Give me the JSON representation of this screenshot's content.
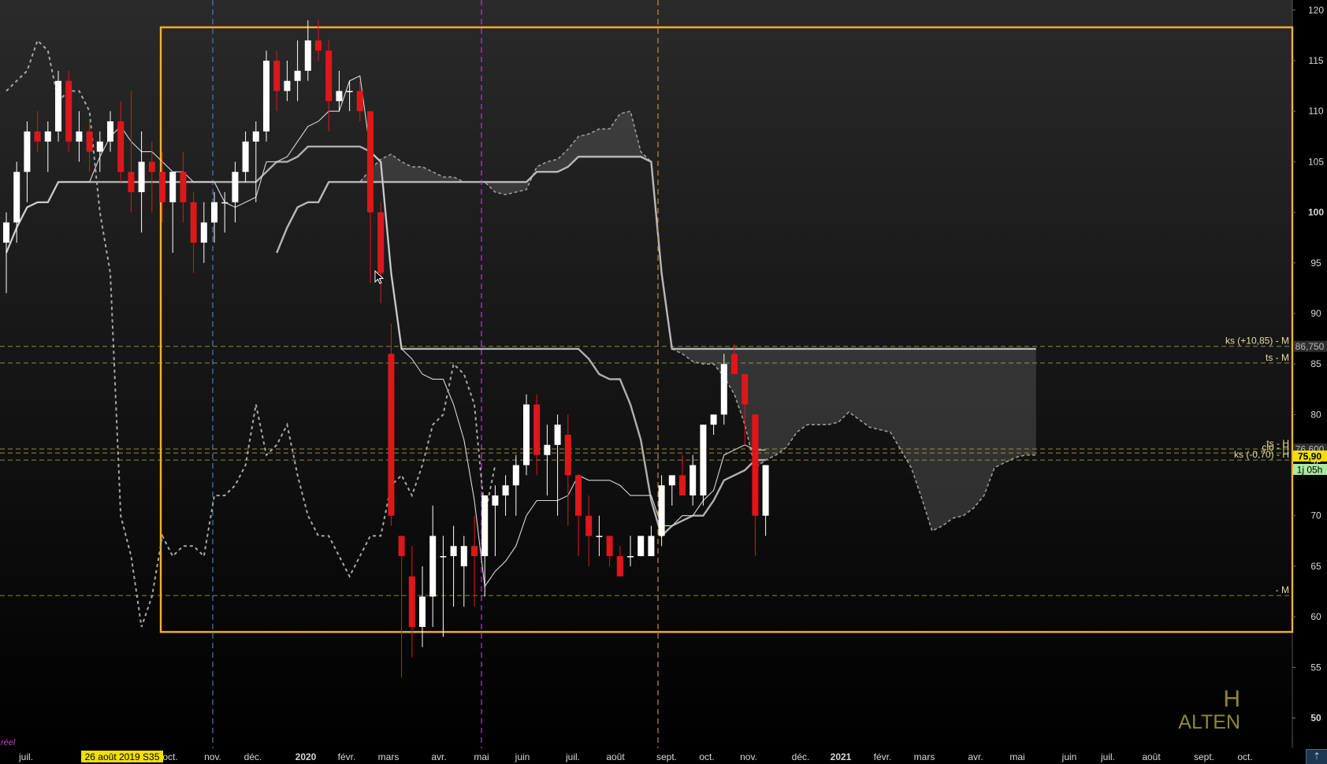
{
  "instrument": {
    "name": "ALTEN",
    "timeframe": "H"
  },
  "corner_label": "réel",
  "colors": {
    "background_top": "#2a2a2a",
    "background_bottom": "#000000",
    "bull_candle": "#ffffff",
    "bear_candle": "#e0161b",
    "box": "#f5b030",
    "kijun": "#b0b0b0",
    "tenkan": "#d8d8d8",
    "chikou": "#a8a8a8",
    "level_line": "#b8b050",
    "cursor_date_bg": "#f0e000",
    "last_price_bg": "#f0e000",
    "timer_bg": "#a8e8a0"
  },
  "chart_data": {
    "type": "candlestick",
    "period": "weekly",
    "ylim": [
      47,
      121
    ],
    "y_ticks": [
      "120",
      "115",
      "110",
      "105",
      "100",
      "95",
      "90",
      "85",
      "80",
      "75",
      "70",
      "65",
      "60",
      "55",
      "50"
    ],
    "x_labels": [
      {
        "text": "juil.",
        "bold": false
      },
      {
        "text": "26 août 2019 S35",
        "bold": false,
        "cursor": true
      },
      {
        "text": "oct.",
        "bold": false
      },
      {
        "text": "nov.",
        "bold": false
      },
      {
        "text": "déc.",
        "bold": false
      },
      {
        "text": "2020",
        "bold": true
      },
      {
        "text": "févr.",
        "bold": false
      },
      {
        "text": "mars",
        "bold": false
      },
      {
        "text": "avr.",
        "bold": false
      },
      {
        "text": "mai",
        "bold": false
      },
      {
        "text": "juin",
        "bold": false
      },
      {
        "text": "juil.",
        "bold": false
      },
      {
        "text": "août",
        "bold": false
      },
      {
        "text": "sept.",
        "bold": false
      },
      {
        "text": "oct.",
        "bold": false
      },
      {
        "text": "nov.",
        "bold": false
      },
      {
        "text": "déc.",
        "bold": false
      },
      {
        "text": "2021",
        "bold": true
      },
      {
        "text": "févr.",
        "bold": false
      },
      {
        "text": "mars",
        "bold": false
      },
      {
        "text": "avr.",
        "bold": false
      },
      {
        "text": "mai",
        "bold": false
      },
      {
        "text": "juin",
        "bold": false
      },
      {
        "text": "juil.",
        "bold": false
      },
      {
        "text": "août",
        "bold": false
      },
      {
        "text": "sept.",
        "bold": false
      },
      {
        "text": "oct.",
        "bold": false
      }
    ],
    "candles": [
      [
        97,
        100,
        92,
        99
      ],
      [
        99,
        105,
        97,
        104
      ],
      [
        104,
        109,
        101,
        108
      ],
      [
        108,
        110,
        106,
        107
      ],
      [
        107,
        109,
        104,
        108
      ],
      [
        108,
        114,
        107,
        113
      ],
      [
        113,
        114,
        106,
        107
      ],
      [
        107,
        110,
        105,
        108
      ],
      [
        108,
        109,
        104,
        106
      ],
      [
        106,
        108,
        104,
        107
      ],
      [
        107,
        110,
        106,
        109
      ],
      [
        109,
        111,
        103,
        104
      ],
      [
        104,
        112,
        100,
        102
      ],
      [
        102,
        108,
        98,
        105
      ],
      [
        105,
        107,
        100,
        104
      ],
      [
        104,
        106,
        99,
        101
      ],
      [
        101,
        103,
        96,
        104
      ],
      [
        104,
        106,
        99,
        101
      ],
      [
        101,
        102,
        94,
        97
      ],
      [
        97,
        101,
        95,
        99
      ],
      [
        99,
        102,
        97,
        101
      ],
      [
        101,
        102,
        98,
        101
      ],
      [
        101,
        105,
        99,
        104
      ],
      [
        104,
        108,
        103,
        107
      ],
      [
        107,
        109,
        101,
        108
      ],
      [
        108,
        116,
        107,
        115
      ],
      [
        115,
        116,
        110,
        112
      ],
      [
        112,
        115,
        111,
        113
      ],
      [
        113,
        117,
        111,
        114
      ],
      [
        114,
        119,
        113,
        117
      ],
      [
        117,
        119,
        115,
        116
      ],
      [
        116,
        117,
        108,
        111
      ],
      [
        111,
        114,
        110,
        112
      ],
      [
        112,
        113,
        110,
        112
      ],
      [
        112,
        113,
        109,
        110
      ],
      [
        110,
        108,
        93,
        100
      ],
      [
        100,
        101,
        91,
        94
      ],
      [
        86,
        89,
        69,
        70
      ],
      [
        68,
        68,
        54,
        66
      ],
      [
        64,
        67,
        56,
        59
      ],
      [
        59,
        65,
        57,
        62
      ],
      [
        62,
        71,
        59,
        68
      ],
      [
        66,
        68,
        58,
        66
      ],
      [
        66,
        69,
        61,
        67
      ],
      [
        65,
        68,
        61,
        67
      ],
      [
        67,
        70,
        61,
        66
      ],
      [
        66,
        72,
        62,
        72
      ],
      [
        71,
        73,
        66,
        72
      ],
      [
        72,
        74,
        70,
        73
      ],
      [
        73,
        76,
        70,
        75
      ],
      [
        75,
        82,
        74,
        81
      ],
      [
        81,
        82,
        74,
        76
      ],
      [
        76,
        79,
        72,
        77
      ],
      [
        77,
        80,
        70,
        79
      ],
      [
        78,
        80,
        69,
        74
      ],
      [
        74,
        74,
        66,
        70
      ],
      [
        70,
        72,
        65,
        68
      ],
      [
        68,
        70,
        66,
        68
      ],
      [
        68,
        68,
        65,
        66
      ],
      [
        66,
        67,
        64,
        64
      ],
      [
        66,
        68,
        65,
        66
      ],
      [
        66,
        68,
        66,
        68
      ],
      [
        66,
        69,
        66,
        68
      ],
      [
        68,
        74,
        67,
        73
      ],
      [
        73,
        74,
        71,
        74
      ],
      [
        74,
        76,
        72,
        72
      ],
      [
        72,
        76,
        71,
        75
      ],
      [
        72,
        79,
        71,
        79
      ],
      [
        79,
        80,
        78,
        80
      ],
      [
        80,
        86,
        79,
        85
      ],
      [
        86,
        87,
        84,
        84
      ],
      [
        84,
        83,
        77,
        81
      ],
      [
        80,
        80,
        66,
        70
      ],
      [
        70,
        75,
        68,
        75
      ]
    ],
    "box": {
      "x_from": "2019-08-26",
      "high": 118.3,
      "low": 58.5
    },
    "horizontal_levels": [
      {
        "label": "ks (+10,85) - M",
        "value": 86.75,
        "badge": "86,750"
      },
      {
        "label": "ts - M",
        "value": 85.1
      },
      {
        "label": "ts - H",
        "value": 76.6,
        "badge": "76,600"
      },
      {
        "label": "clo - H",
        "value": 76.2
      },
      {
        "label": "ks (-0,70) - H",
        "value": 75.5
      },
      {
        "label": "- M",
        "value": 62.1
      }
    ],
    "last_price": "75,90",
    "timer": "1j 05h"
  }
}
